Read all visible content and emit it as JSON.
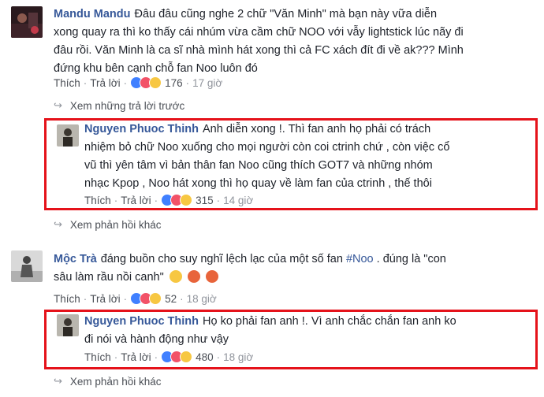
{
  "comments": [
    {
      "author": "Mandu Mandu",
      "lines": [
        "Đâu đâu cũng nghe 2 chữ \"Văn Minh\" mà bạn này vữa diễn",
        "xong quay ra thì ko thấy cái nhúm vừa cầm chữ NOO với vẫy lightstick lúc nãy đi",
        "đâu rồi. Văn Minh là ca sĩ nhà mình hát xong thì cả FC xách đít đi về ak??? Mình",
        "đứng khu bên cạnh chỗ fan Noo luôn đó"
      ],
      "like_label": "Thích",
      "reply_label": "Trả lời",
      "reaction_count": "176",
      "time": "17 giờ"
    },
    {
      "author": "Mộc Trà",
      "text_before": "đáng buồn cho suy nghĩ lệch lạc của một số fan ",
      "hashtag": "#Noo",
      "text_after": " . đúng là \"con",
      "line2": "sâu làm rầu nồi canh\"",
      "like_label": "Thích",
      "reply_label": "Trả lời",
      "reaction_count": "52",
      "time": "18 giờ"
    }
  ],
  "replies": [
    {
      "author": "Nguyen Phuoc Thinh",
      "lines": [
        "Anh diễn xong !. Thì fan anh họ phải có trách",
        "nhiệm bỏ chữ Noo xuống cho mọi người còn coi ctrinh chứ , còn việc cổ",
        "vũ thì yên tâm vì bản thân fan Noo cũng thích GOT7 và những nhóm",
        "nhạc Kpop , Noo hát xong thì họ quay về làm fan của ctrinh , thế thôi"
      ],
      "like_label": "Thích",
      "reply_label": "Trả lời",
      "reaction_count": "315",
      "time": "14 giờ"
    },
    {
      "author": "Nguyen Phuoc Thinh",
      "lines": [
        "Họ ko phải fan anh !. Vì anh chắc chắn fan anh ko",
        "đi nói và hành động như vậy"
      ],
      "like_label": "Thích",
      "reply_label": "Trả lời",
      "reaction_count": "480",
      "time": "18 giờ"
    }
  ],
  "links": {
    "view_previous": "Xem những trả lời trước",
    "view_more_1": "Xem phản hồi khác",
    "view_more_2": "Xem phản hồi khác"
  },
  "colors": {
    "highlight": "#e5121a",
    "link": "#365899",
    "meta": "#90949c"
  }
}
